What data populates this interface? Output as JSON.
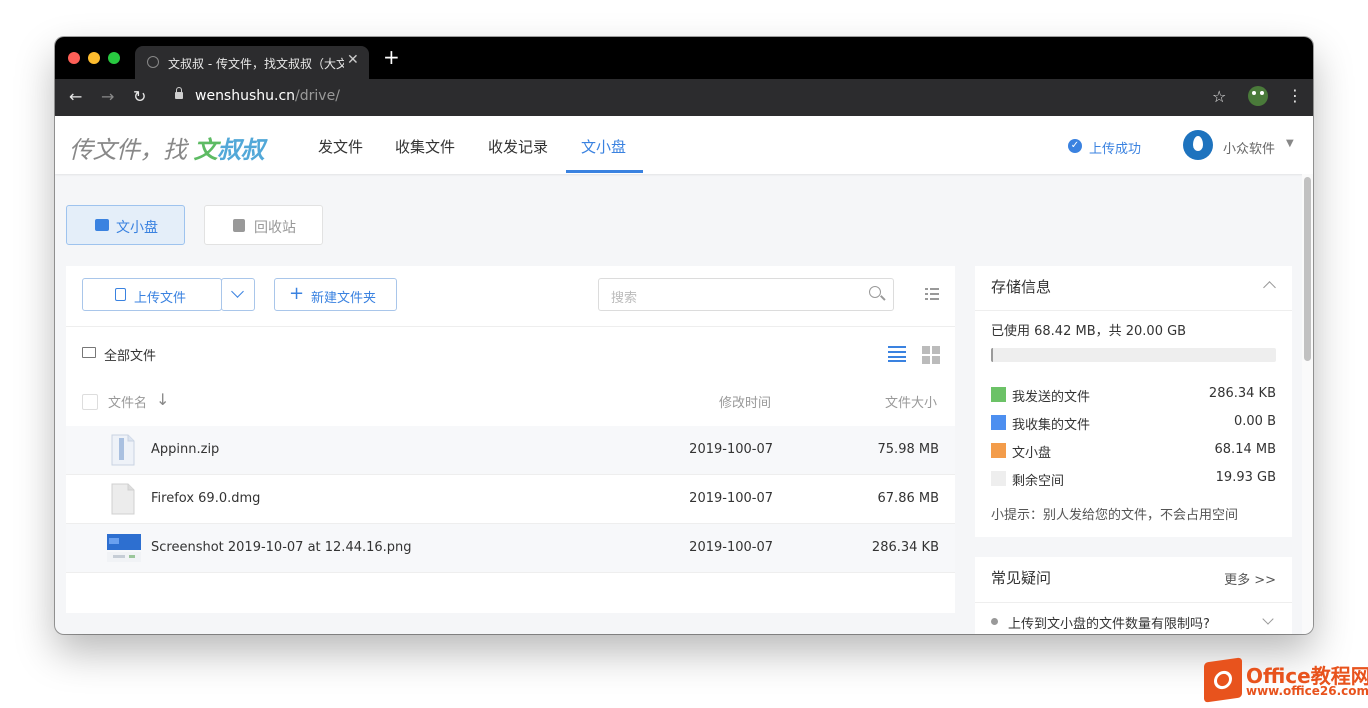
{
  "browser": {
    "tab_title": "文叔叔 - 传文件，找文叔叔（大文件、永不限速）",
    "new_tab": "+",
    "tab_close": "✕",
    "url_host": "wenshushu.cn",
    "url_path": "/drive/"
  },
  "header": {
    "logo_prefix": "传文件，找 ",
    "logo_brand_1": "文",
    "logo_brand_2": "叔叔",
    "nav": [
      "发文件",
      "收集文件",
      "收发记录",
      "文小盘"
    ],
    "active_nav": "文小盘",
    "upload_status": "上传成功",
    "user_name": "小众软件"
  },
  "tabs": {
    "drive": "文小盘",
    "recycle": "回收站"
  },
  "toolbar": {
    "upload": "上传文件",
    "new_folder": "新建文件夹",
    "search_placeholder": "搜索"
  },
  "breadcrumb": "全部文件",
  "table": {
    "headers": {
      "name": "文件名",
      "modified": "修改时间",
      "size": "文件大小"
    },
    "rows": [
      {
        "name": "Appinn.zip",
        "modified": "2019-100-07",
        "size": "75.98 MB"
      },
      {
        "name": "Firefox 69.0.dmg",
        "modified": "2019-100-07",
        "size": "67.86 MB"
      },
      {
        "name": "Screenshot 2019-10-07 at 12.44.16.png",
        "modified": "2019-100-07",
        "size": "286.34 KB"
      }
    ]
  },
  "storage": {
    "title": "存储信息",
    "used_text": "已使用 68.42 MB，共 20.00 GB",
    "used_fraction": 0.0034,
    "legend": [
      {
        "label": "我发送的文件",
        "value": "286.34 KB",
        "color": "#6cc267"
      },
      {
        "label": "我收集的文件",
        "value": "0.00 B",
        "color": "#4d8ff0"
      },
      {
        "label": "文小盘",
        "value": "68.14 MB",
        "color": "#f39c4a"
      },
      {
        "label": "剩余空间",
        "value": "19.93 GB",
        "color": "#eeeeee"
      }
    ],
    "tip": "小提示：别人发给您的文件，不会占用空间"
  },
  "faq": {
    "title": "常见疑问",
    "more": "更多 >>",
    "q1": "上传到文小盘的文件数量有限制吗?"
  },
  "watermark": {
    "line1": "Office教程网",
    "line2": "www.office26.com"
  },
  "colors": {
    "accent": "#3a82e0"
  }
}
